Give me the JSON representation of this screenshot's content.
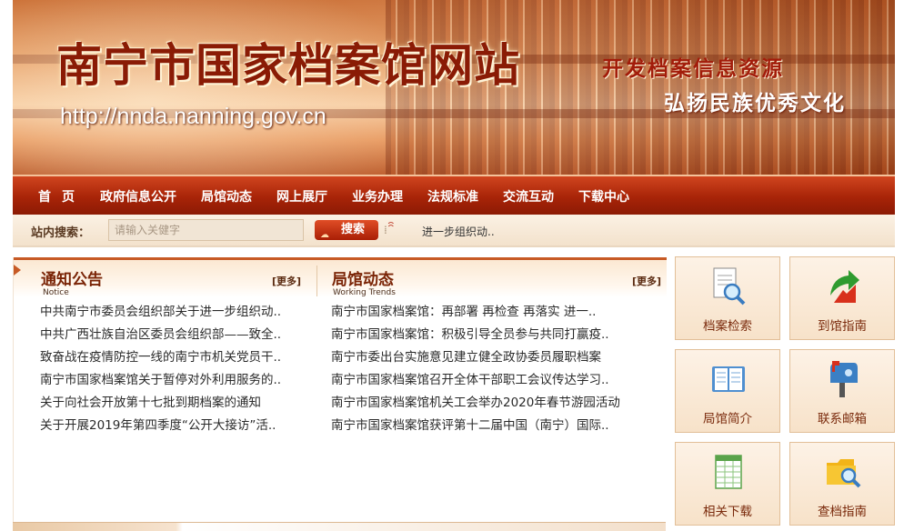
{
  "banner": {
    "title": "南宁市国家档案馆网站",
    "url": "http://nnda.nanning.gov.cn",
    "slogan_1": "开发档案信息资源",
    "slogan_2": "弘扬民族优秀文化"
  },
  "nav": {
    "items": [
      "首页",
      "政府信息公开",
      "局馆动态",
      "网上展厅",
      "业务办理",
      "法规标准",
      "交流互动",
      "下载中心"
    ]
  },
  "search": {
    "label": "站内搜索：",
    "placeholder": "请输入关健字",
    "button": "搜索",
    "ticker": "进一步组织动.."
  },
  "notice": {
    "title": "通知公告",
    "subtitle": "Notice",
    "more": "[更多]",
    "items": [
      "中共南宁市委员会组织部关于进一步组织动..",
      "中共广西壮族自治区委员会组织部——致全..",
      "致奋战在疫情防控一线的南宁市机关党员干..",
      "南宁市国家档案馆关于暂停对外利用服务的..",
      "关于向社会开放第十七批到期档案的通知",
      "关于开展2019年第四季度“公开大接访”活.."
    ]
  },
  "trends": {
    "title": "局馆动态",
    "subtitle": "Working Trends",
    "more": "[更多]",
    "items": [
      "南宁市国家档案馆：再部署 再检查 再落实 进一..",
      "南宁市国家档案馆：积极引导全员参与共同打赢疫..",
      "南宁市委出台实施意见建立健全政协委员履职档案",
      "南宁市国家档案馆召开全体干部职工会议传达学习..",
      "南宁市国家档案馆机关工会举办2020年春节游园活动",
      "南宁市国家档案馆获评第十二届中国（南宁）国际.."
    ]
  },
  "quicklinks": [
    {
      "label": "档案检索",
      "icon": "document-search-icon"
    },
    {
      "label": "到馆指南",
      "icon": "arrow-guide-icon"
    },
    {
      "label": "局馆简介",
      "icon": "open-book-icon"
    },
    {
      "label": "联系邮箱",
      "icon": "mailbox-icon"
    },
    {
      "label": "相关下载",
      "icon": "spreadsheet-download-icon"
    },
    {
      "label": "查档指南",
      "icon": "folder-search-icon"
    }
  ],
  "colors": {
    "nav_red": "#a82408",
    "title_red": "#8a1b05",
    "tile_bg": "#f7e2c9"
  }
}
